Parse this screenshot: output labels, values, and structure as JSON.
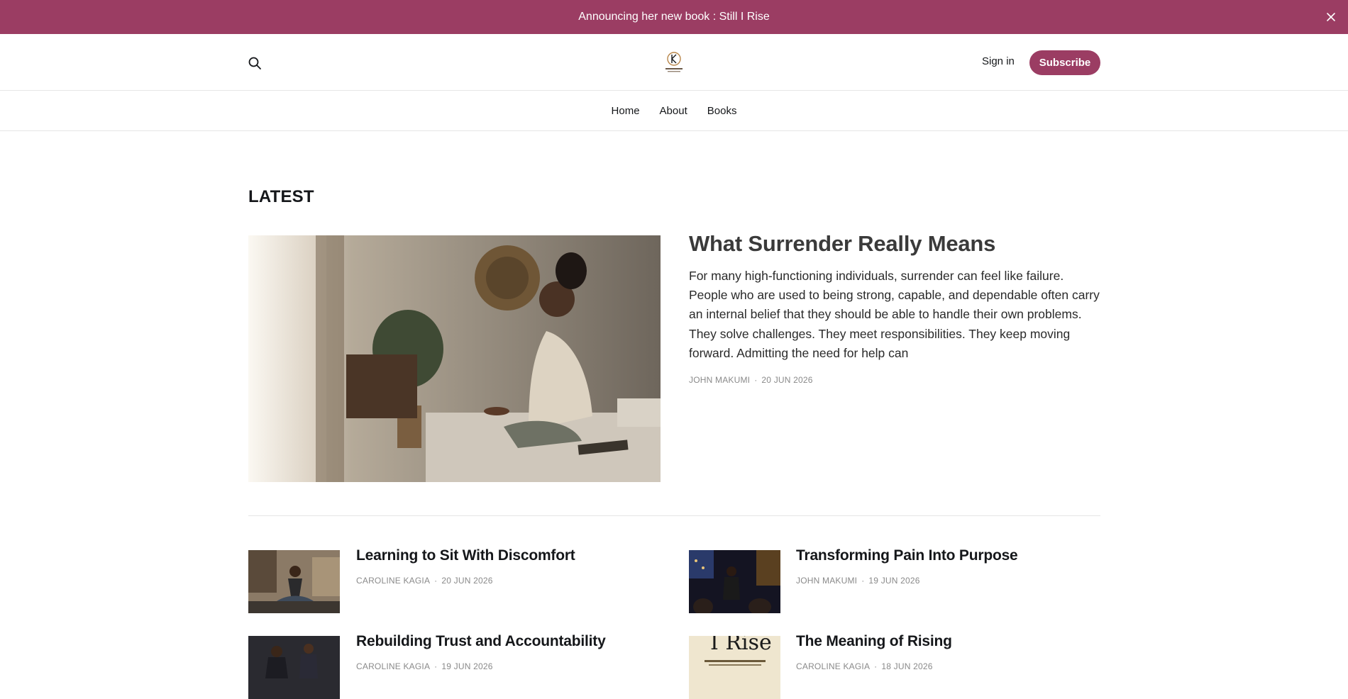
{
  "announcement": {
    "text": "Announcing her new book : Still I Rise",
    "close_icon": "close-icon"
  },
  "header": {
    "search_icon": "search-icon",
    "logo_text": "Caroline Kagia",
    "signin_label": "Sign in",
    "subscribe_label": "Subscribe"
  },
  "nav": {
    "items": [
      {
        "label": "Home"
      },
      {
        "label": "About"
      },
      {
        "label": "Books"
      }
    ]
  },
  "latest": {
    "section_title": "LATEST",
    "featured": {
      "title": "What Surrender Really Means",
      "excerpt": "For many high-functioning individuals, surrender can feel like failure. People who are used to being strong, capable, and dependable often carry an internal belief that they should be able to handle their own problems. They solve challenges. They meet responsibilities. They keep moving forward. Admitting the need for help can",
      "author": "JOHN MAKUMI",
      "date": "20 JUN 2026"
    },
    "posts": [
      {
        "title": "Learning to Sit With Discomfort",
        "author": "CAROLINE KAGIA",
        "date": "20 JUN 2026"
      },
      {
        "title": "Transforming Pain Into Purpose",
        "author": "JOHN MAKUMI",
        "date": "19 JUN 2026"
      },
      {
        "title": "Rebuilding Trust and Accountability",
        "author": "CAROLINE KAGIA",
        "date": "19 JUN 2026"
      },
      {
        "title": "The Meaning of Rising",
        "author": "CAROLINE KAGIA",
        "date": "18 JUN 2026"
      }
    ],
    "book_cover_text": "I Rise"
  },
  "colors": {
    "brand": "#9b3d63",
    "text": "#15171a",
    "meta": "#8a8a8a",
    "divider": "#e6e6e6"
  }
}
